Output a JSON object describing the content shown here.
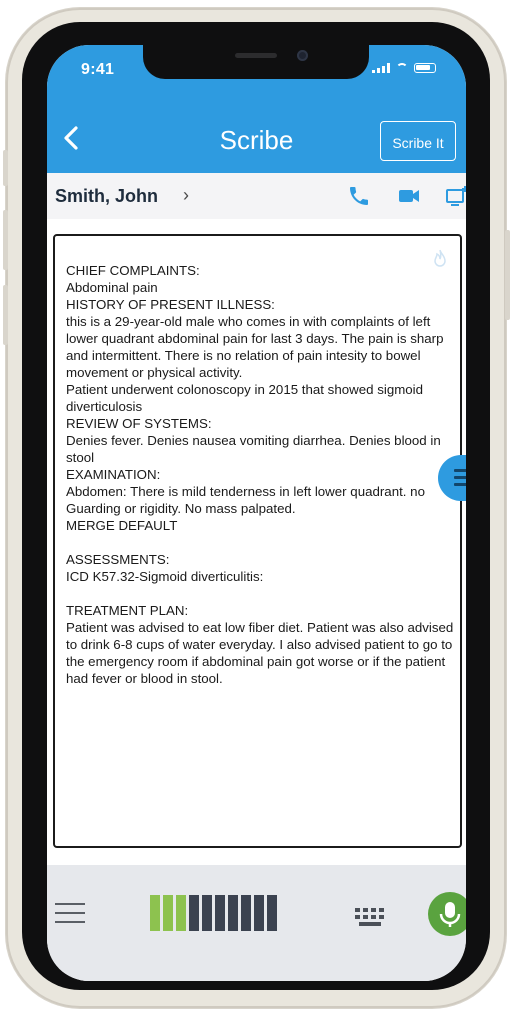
{
  "status_bar": {
    "time": "9:41"
  },
  "header": {
    "back_icon": "chevron-left-icon",
    "title": "Scribe",
    "action_label": "Scribe It"
  },
  "patient": {
    "name": "Smith, John",
    "chevron": "›"
  },
  "note": {
    "text": "CHIEF COMPLAINTS:\nAbdominal pain\nHISTORY OF PRESENT ILLNESS:\nthis is a 29-year-old male who comes in with complaints of left lower quadrant abdominal pain for last 3 days. The pain is sharp and intermittent. There is no relation of pain intesity to bowel movement or physical activity.\nPatient underwent colonoscopy in 2015 that showed sigmoid diverticulosis\nREVIEW OF SYSTEMS:\nDenies fever. Denies nausea vomiting diarrhea. Denies blood in stool\nEXAMINATION:\nAbdomen: There is mild tenderness in left lower quadrant. no Guarding or rigidity. No mass palpated.\nMERGE DEFAULT\n\nASSESSMENTS:\nICD K57.32-Sigmoid diverticulitis:\n\nTREATMENT PLAN:\nPatient was advised to eat low fiber diet. Patient was also advised to drink 6-8 cups of water everyday. I also advised patient to go to the emergency room if abdominal pain got worse or if the patient had fever or blood in stool."
  },
  "audio_meter": {
    "level": 0.3,
    "bars_total": 10,
    "active_color": "#8dc24f",
    "inactive_color": "#3b4250"
  },
  "colors": {
    "accent": "#2e9be0",
    "mic": "#5aa33f"
  }
}
